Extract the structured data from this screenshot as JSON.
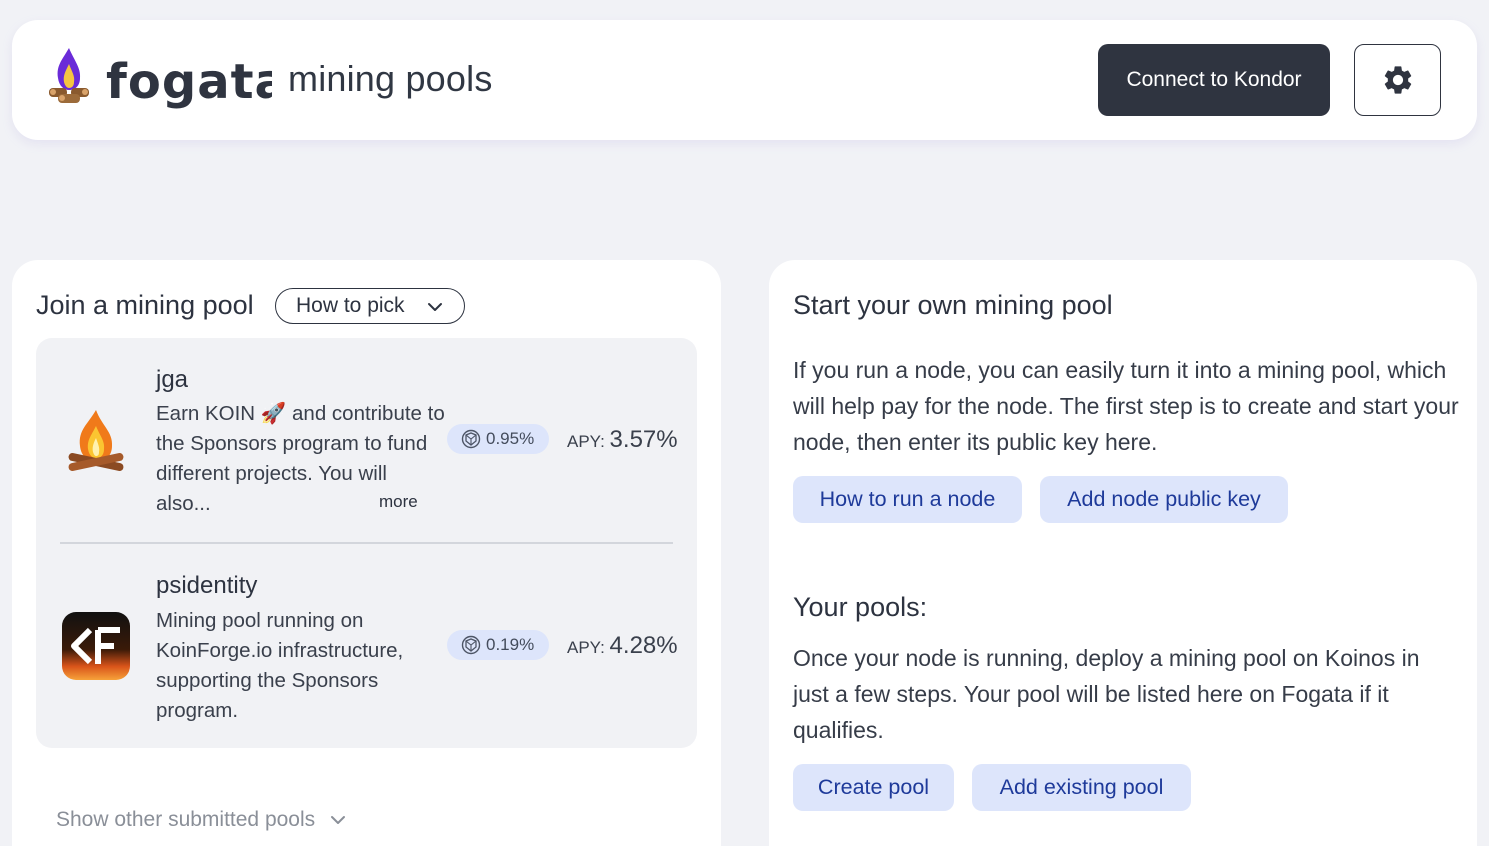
{
  "header": {
    "brand": "fogata",
    "subtitle": "mining pools",
    "connect_label": "Connect to Kondor",
    "logo_icon": "campfire-logo-icon",
    "settings_icon": "gear-icon"
  },
  "join": {
    "title": "Join a mining pool",
    "pick_label": "How to pick",
    "pools": [
      {
        "name": "jga",
        "description": "Earn KOIN 🚀 and contribute to the Sponsors program to fund different projects. You will also...",
        "more_label": "more",
        "fee": "0.95%",
        "apy_label": "APY:",
        "apy_value": "3.57%",
        "avatar_icon": "campfire-avatar-icon"
      },
      {
        "name": "psidentity",
        "description": "Mining pool running on KoinForge.io infrastructure, supporting the Sponsors program.",
        "fee": "0.19%",
        "apy_label": "APY:",
        "apy_value": "4.28%",
        "avatar_icon": "koinforge-logo-icon"
      }
    ],
    "show_other_label": "Show other submitted pools"
  },
  "start": {
    "title": "Start your own mining pool",
    "intro": "If you run a node, you can easily turn it into a mining pool, which will help pay for the node. The first step is to create and start your node, then enter its public key here.",
    "how_to_run_label": "How to run a node",
    "add_key_label": "Add node public key",
    "your_pools_title": "Your pools:",
    "your_pools_text": "Once your node is running, deploy a mining pool on Koinos in just a few steps. Your pool will be listed here on Fogata if it qualifies.",
    "create_label": "Create pool",
    "add_existing_label": "Add existing pool"
  },
  "colors": {
    "background": "#f1f2f6",
    "dark_button": "#2f3440",
    "light_button": "#dde5fb",
    "light_button_text": "#1e3a9a"
  }
}
